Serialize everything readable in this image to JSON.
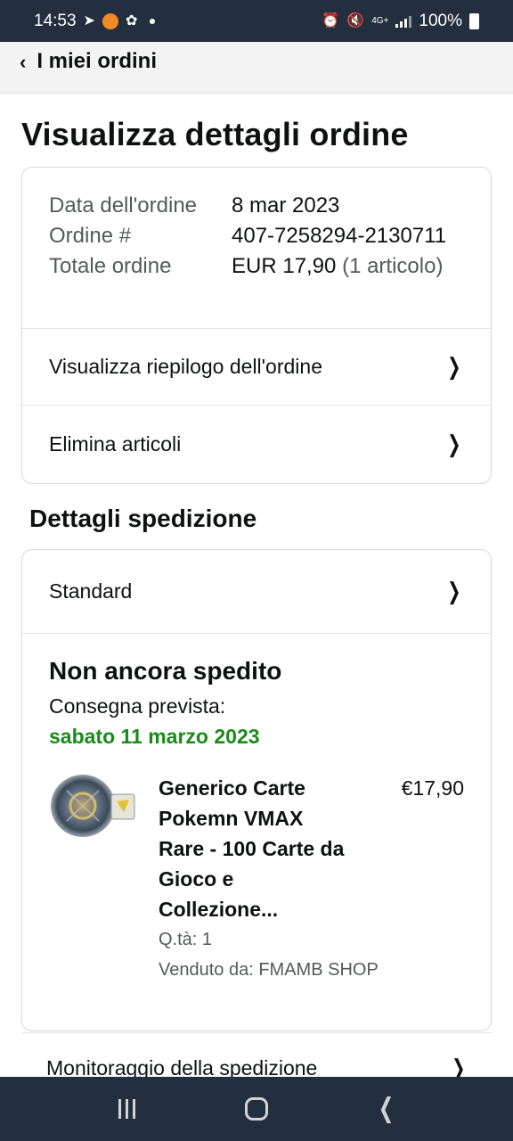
{
  "status_bar": {
    "time": "14:53",
    "battery": "100%",
    "network": "4G+"
  },
  "topnav": {
    "back_label": "I miei ordini"
  },
  "page": {
    "title": "Visualizza dettagli ordine"
  },
  "order": {
    "date_label": "Data dell'ordine",
    "date_value": "8 mar 2023",
    "number_label": "Ordine #",
    "number_value": "407-7258294-2130711",
    "total_label": "Totale ordine",
    "total_value": "EUR 17,90",
    "total_items": "(1 articolo)",
    "summary_link": "Visualizza riepilogo dell'ordine",
    "delete_link": "Elimina articoli"
  },
  "shipping": {
    "section_title": "Dettagli spedizione",
    "method": "Standard",
    "status": "Non ancora spedito",
    "expected_label": "Consegna prevista:",
    "expected_date": "sabato 11 marzo 2023",
    "date_color": "#1a8a1a",
    "item": {
      "title": "Generico Carte Pokemn VMAX Rare - 100 Carte da Gioco e Collezione...",
      "price": "€17,90",
      "qty": "Q.tà: 1",
      "seller": "Venduto da: FMAMB SHOP",
      "thumbnail_icon": "product-thumbnail"
    },
    "tracking_link": "Monitoraggio della spedizione"
  },
  "colors": {
    "header_bg": "#232f3e",
    "accent_green": "#1a8a1a"
  }
}
